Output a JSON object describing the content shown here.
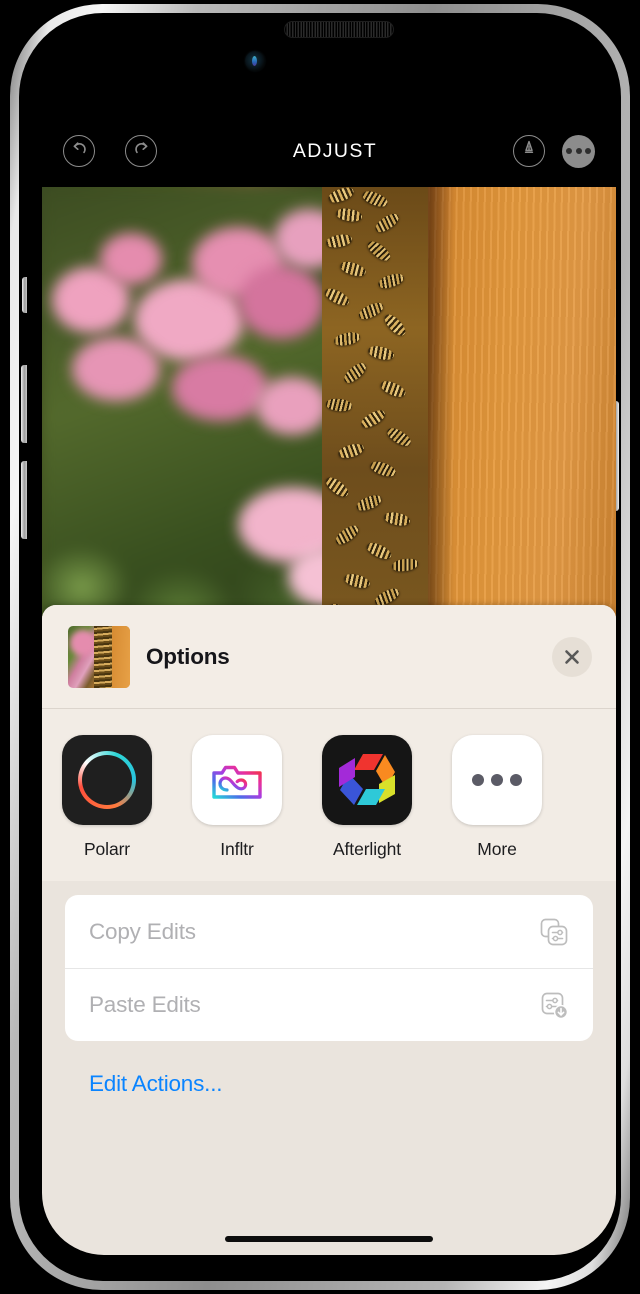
{
  "device": {
    "frame": "iphone",
    "speaker_icon": "speaker-grille-icon",
    "camera_icon": "front-camera-icon",
    "home_indicator": "home-indicator"
  },
  "editor": {
    "title": "ADJUST",
    "undo_icon": "undo-icon",
    "redo_icon": "redo-icon",
    "markup_icon": "markup-pen-icon",
    "more_icon": "ellipsis-icon",
    "photo_description": "Close-up of honeybees clustered on an orange wooden beehive with blurred pink nerine lilies and green foliage behind",
    "colors": {
      "toolbar_background": "#000000",
      "toolbar_icon": "#8c8c8c",
      "title_text": "#ffffff",
      "wood_orange": "#e69a3d",
      "flower_pink": "#e58cae",
      "foliage_green": "#53692c"
    }
  },
  "share_sheet": {
    "title": "Options",
    "thumbnail_icon": "photo-thumbnail",
    "close_icon": "close-icon",
    "apps": [
      {
        "label": "Polarr",
        "icon": "polarr-app-icon"
      },
      {
        "label": "Infltr",
        "icon": "infltr-app-icon"
      },
      {
        "label": "Afterlight",
        "icon": "afterlight-app-icon"
      },
      {
        "label": "More",
        "icon": "more-apps-icon"
      }
    ],
    "actions": [
      {
        "label": "Copy Edits",
        "icon": "copy-edits-icon",
        "enabled": false
      },
      {
        "label": "Paste Edits",
        "icon": "paste-edits-icon",
        "enabled": false
      }
    ],
    "edit_actions_label": "Edit Actions...",
    "colors": {
      "sheet_background": "#eae4dd",
      "header_background": "#f3ede6",
      "app_row_background": "#f2ece5",
      "list_background": "#ffffff",
      "title_text": "#16161a",
      "disabled_text": "#b0b0b3",
      "link_blue": "#0a84ff"
    }
  }
}
